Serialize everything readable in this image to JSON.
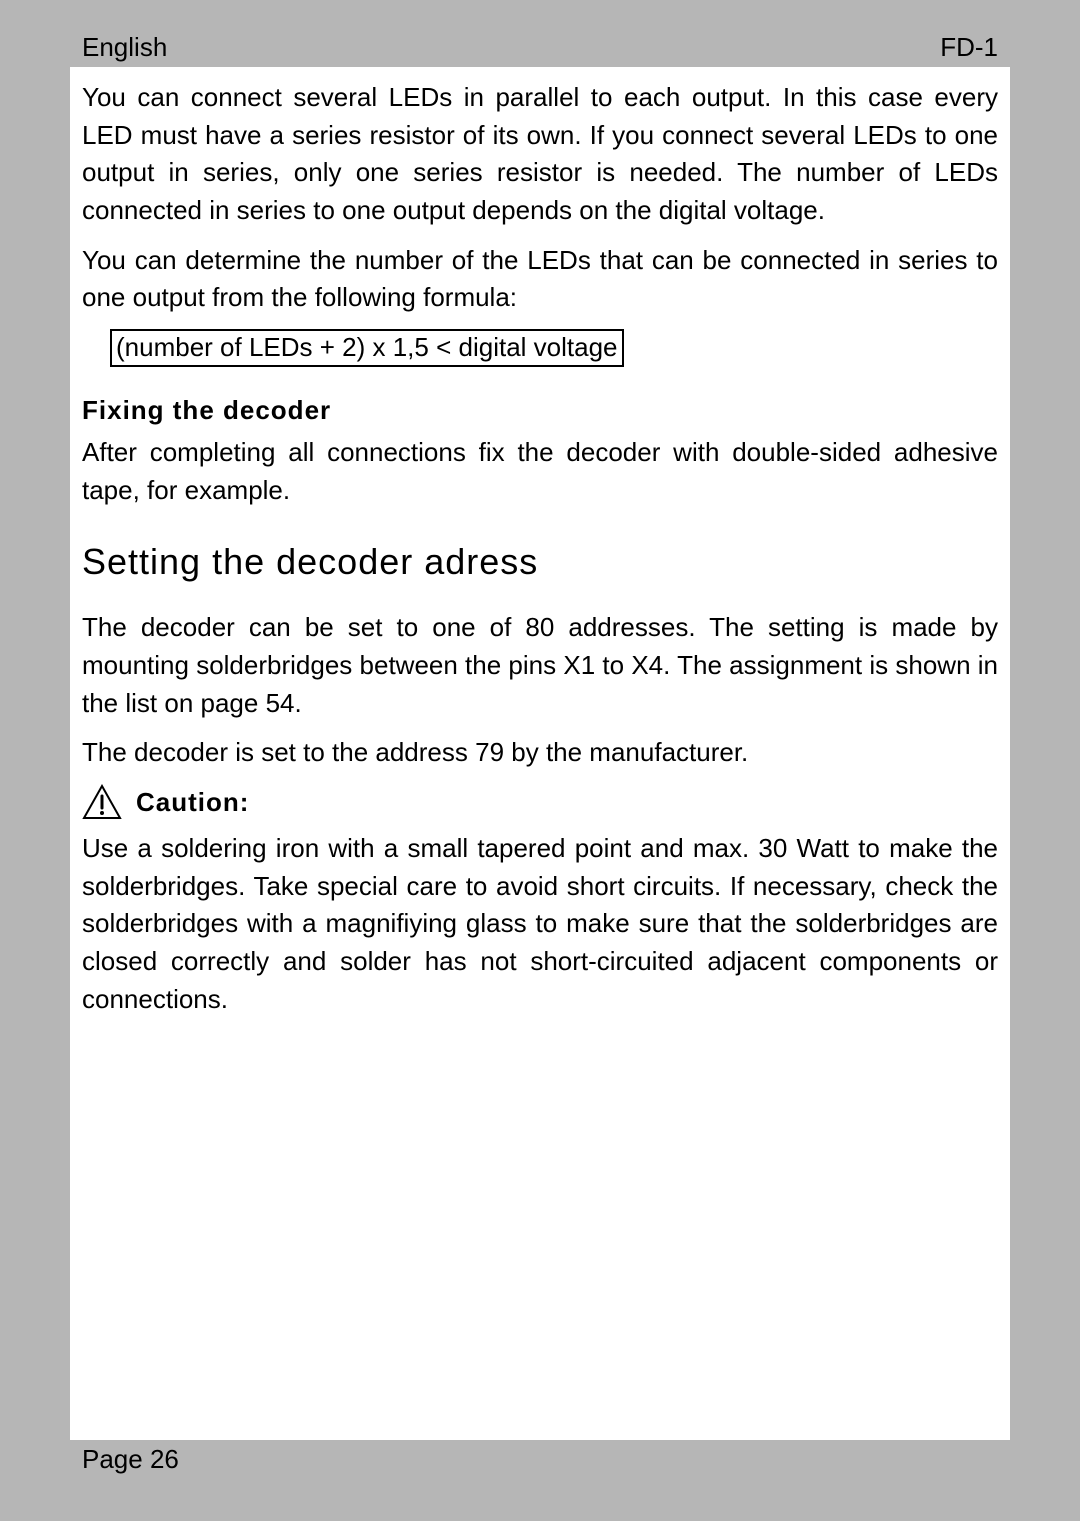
{
  "header": {
    "language": "English",
    "doc_code": "FD-1"
  },
  "paragraphs": {
    "p1": "You can connect several LEDs in parallel to each output. In this case every LED must have a series resistor of its own. If you connect several LEDs to one output in series, only one series resistor is needed. The number of LEDs connected in series to one output depends on the digital voltage.",
    "p2": "You can determine the number of the LEDs that can be connected in series to one output from the following formula:",
    "formula": "(number of LEDs + 2) x 1,5 < digital voltage",
    "sub1_title": "Fixing the decoder",
    "p3": "After completing all connections fix the decoder with double-sided adhesive tape, for example.",
    "section_title": "Setting the decoder adress",
    "p4": "The decoder can be set to one of 80 addresses. The setting is made by mounting solderbridges between the pins X1 to X4. The assignment is shown in the list on page 54.",
    "p5": "The decoder is set to the address 79 by the manufacturer.",
    "caution_label": "Caution:",
    "p6": "Use a soldering iron with a small tapered point and max. 30 Watt to make the solderbridges. Take special care to avoid short circuits. If necessary, check the solderbridges with a magnifiying glass to make sure that the solderbridges are closed correctly and solder has not short-circuited adjacent components or connections."
  },
  "footer": {
    "page_label": "Page 26"
  }
}
